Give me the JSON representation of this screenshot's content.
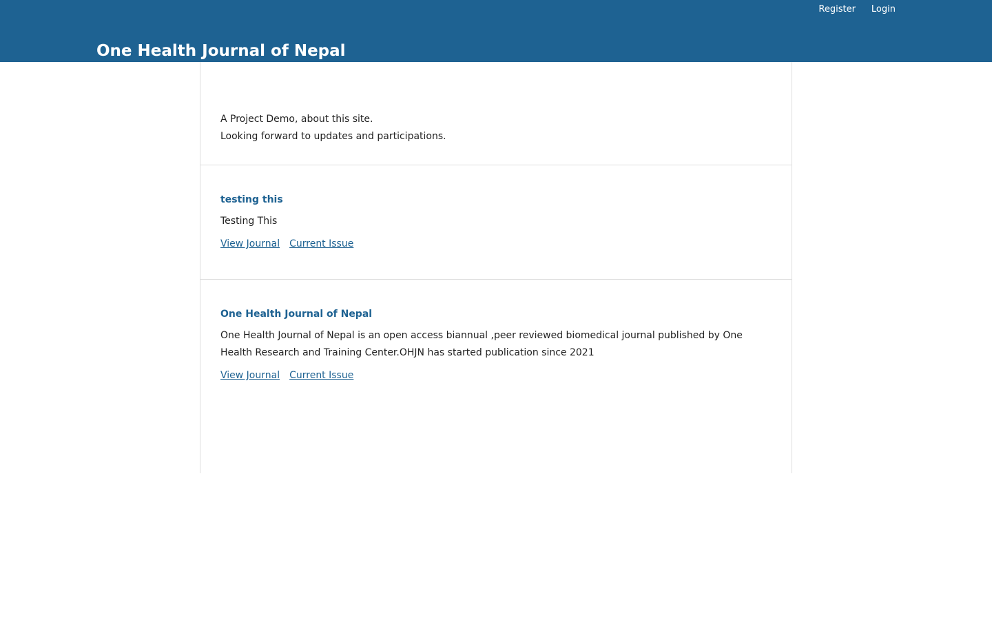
{
  "header": {
    "site_title": "One Health Journal of Nepal",
    "user_nav": {
      "register": "Register",
      "login": "Login"
    },
    "background_color": "#1e6292"
  },
  "about": {
    "line1": "A Project Demo, about this site.",
    "line2": "Looking forward to updates and participations."
  },
  "journals": [
    {
      "title": "testing this",
      "description": "Testing This",
      "view_label": "View Journal",
      "current_label": "Current Issue"
    },
    {
      "title": "One Health Journal of Nepal",
      "description": "One Health Journal of Nepal is an open access biannual ,peer reviewed biomedical journal published by One Health Research and Training Center.OHJN has started publication since 2021",
      "view_label": "View Journal",
      "current_label": "Current Issue"
    }
  ],
  "colors": {
    "link": "#1e6292",
    "text": "#222222",
    "border": "#dddddd"
  }
}
